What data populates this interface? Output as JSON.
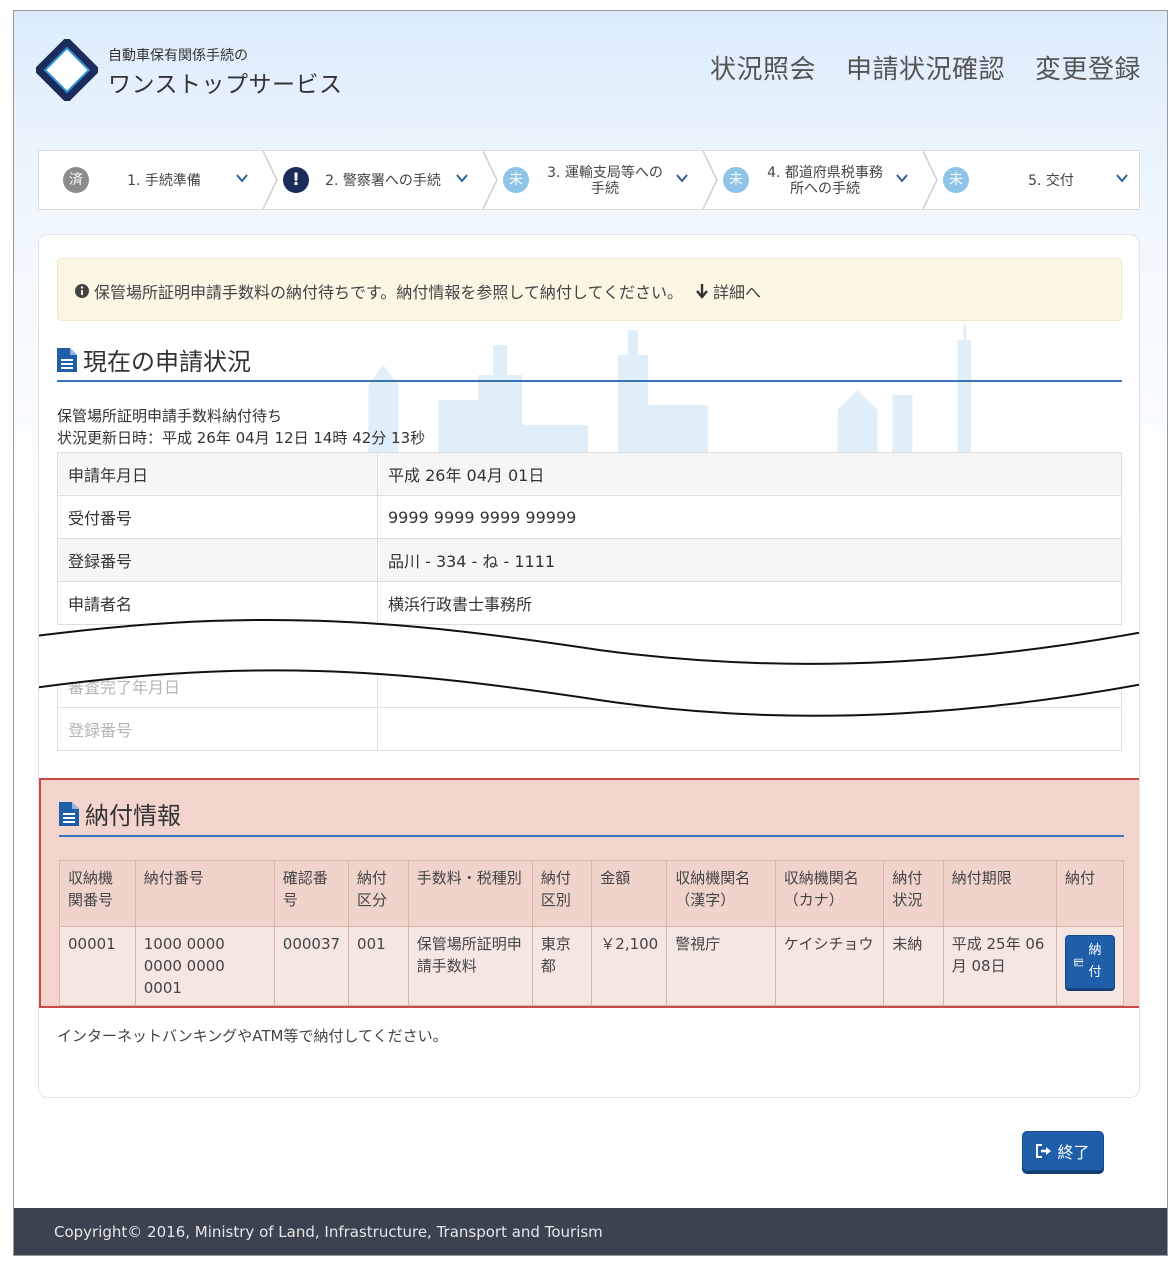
{
  "header": {
    "logo_sub": "自動車保有関係手続の",
    "logo_main": "ワンストップサービス",
    "nav": [
      "状況照会",
      "申請状況確認",
      "変更登録"
    ]
  },
  "steps": [
    {
      "badge": "済",
      "label": "1. 手続準備",
      "label2": ""
    },
    {
      "badge": "!",
      "label": "2. 警察署への手続",
      "label2": ""
    },
    {
      "badge": "未",
      "label": "3. 運輸支局等への",
      "label2": "手続"
    },
    {
      "badge": "未",
      "label": "4. 都道府県税事務",
      "label2": "所への手続"
    },
    {
      "badge": "未",
      "label": "5. 交付",
      "label2": ""
    }
  ],
  "alert": {
    "message": "保管場所証明申請手数料の納付待ちです。納付情報を参照して納付してください。",
    "link": "詳細へ"
  },
  "current": {
    "title": "現在の申請状況",
    "status": "保管場所証明申請手数料納付待ち",
    "updated": "状況更新日時：平成 26年 04月 12日 14時 42分 13秒",
    "rows": [
      {
        "key": "申請年月日",
        "value": "平成 26年 04月 01日"
      },
      {
        "key": "受付番号",
        "value": "9999 9999 9999 99999"
      },
      {
        "key": "登録番号",
        "value": "品川 - 334 - ね - 1111"
      },
      {
        "key": "申請者名",
        "value": "横浜行政書士事務所"
      }
    ],
    "rows_after": [
      {
        "key": "審査完了年月日",
        "value": ""
      },
      {
        "key": "登録番号",
        "value": ""
      }
    ]
  },
  "payment": {
    "title": "納付情報",
    "headers": [
      "収納機関番号",
      "納付番号",
      "確認番号",
      "納付区分",
      "手数料・税種別",
      "納付区別",
      "金額",
      "収納機関名（漢字）",
      "収納機関名（カナ）",
      "納付状況",
      "納付期限",
      "納付"
    ],
    "row": [
      "00001",
      "1000 0000 0000 0000 0001",
      "000037",
      "001",
      "保管場所証明申請手数料",
      "東京都",
      "￥2,100",
      "警視庁",
      "ケイシチョウ",
      "未納",
      "平成 25年 06月 08日"
    ],
    "pay_button": "納付",
    "note": "インターネットバンキングやATM等で納付してください。"
  },
  "end_button": "終了",
  "footer": "Copyright© 2016, Ministry of Land, Infrastructure, Transport and Tourism"
}
